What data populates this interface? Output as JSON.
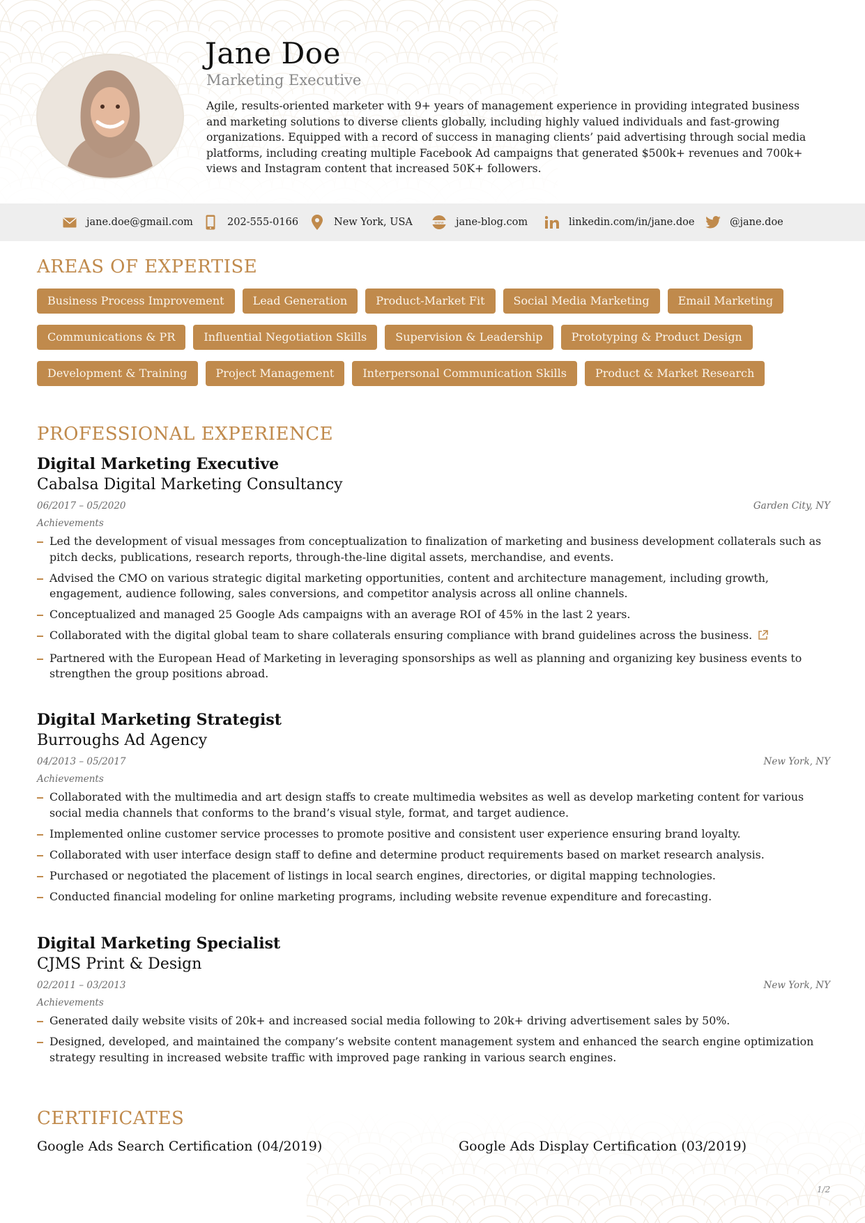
{
  "header": {
    "name": "Jane Doe",
    "title": "Marketing Executive",
    "summary": "Agile, results-oriented marketer with 9+ years of management experience in providing integrated business and marketing solutions to diverse clients globally, including highly valued individuals and fast-growing organizations. Equipped with a record of success in managing clients’ paid advertising through social media platforms, including creating multiple Facebook Ad campaigns that generated $500k+ revenues and 700k+ views and Instagram content that increased 50K+ followers."
  },
  "contact": {
    "email": "jane.doe@gmail.com",
    "phone": "202-555-0166",
    "location": "New York, USA",
    "website": "jane-blog.com",
    "website_icon_text": "www",
    "linkedin": "linkedin.com/in/jane.doe",
    "twitter": "@jane.doe",
    "icons": [
      "envelope-icon",
      "phone-icon",
      "map-pin-icon",
      "globe-icon",
      "linkedin-icon",
      "twitter-icon"
    ]
  },
  "expertise": {
    "heading": "AREAS OF EXPERTISE",
    "rows": [
      [
        "Business Process Improvement",
        "Lead Generation",
        "Product-Market Fit",
        "Social Media Marketing",
        "Email Marketing"
      ],
      [
        "Communications & PR",
        "Influential Negotiation Skills",
        "Supervision & Leadership",
        "Prototyping & Product Design"
      ],
      [
        "Development & Training",
        "Project Management",
        "Interpersonal Communication Skills",
        "Product & Market Research"
      ]
    ]
  },
  "experience": {
    "heading": "PROFESSIONAL EXPERIENCE",
    "jobs": [
      {
        "role": "Digital Marketing Executive",
        "company": "Cabalsa Digital Marketing Consultancy",
        "dates": "06/2017 – 05/2020",
        "location": "Garden City, NY",
        "achievements_label": "Achievements",
        "bullets": [
          "Led the development of visual messages from conceptualization to finalization of marketing and business development collaterals such as pitch decks, publications, research reports, through-the-line digital assets, merchandise, and events.",
          "Advised the CMO on various strategic digital marketing opportunities, content and architecture management, including growth, engagement, audience following, sales conversions, and competitor analysis across all online channels.",
          "Conceptualized and managed 25 Google Ads campaigns with an average ROI of 45% in the last 2 years.",
          "Collaborated with the digital global team to share collaterals ensuring compliance with brand guidelines across the business.",
          "Partnered with the European Head of Marketing in leveraging sponsorships as well as planning and organizing key business events to strengthen the group positions abroad."
        ]
      },
      {
        "role": "Digital Marketing Strategist",
        "company": "Burroughs Ad Agency",
        "dates": "04/2013 – 05/2017",
        "location": "New York, NY",
        "achievements_label": "Achievements",
        "bullets": [
          "Collaborated with the multimedia and art design staffs to create multimedia websites as well as develop marketing content for various social media channels that conforms to the brand’s visual style, format, and target audience.",
          "Implemented online customer service processes to promote positive and consistent user experience ensuring brand loyalty.",
          "Collaborated with user interface design staff to define and determine product requirements based on market research analysis.",
          "Purchased or negotiated the placement of listings in local search engines, directories, or digital mapping technologies.",
          "Conducted financial modeling for online marketing programs, including website revenue expenditure and forecasting."
        ]
      },
      {
        "role": "Digital Marketing Specialist",
        "company": "CJMS Print & Design",
        "dates": "02/2011 – 03/2013",
        "location": "New York, NY",
        "achievements_label": "Achievements",
        "bullets": [
          "Generated daily website visits of 20k+ and increased social media following to 20k+ driving advertisement sales by 50%.",
          "Designed, developed, and maintained the company’s website content management system and enhanced the search engine optimization strategy resulting in increased website traffic with improved page ranking in various search engines."
        ]
      }
    ]
  },
  "certificates": {
    "heading": "CERTIFICATES",
    "items": [
      "Google Ads Search Certification (04/2019)",
      "Google Ads Display Certification (03/2019)"
    ]
  },
  "page": {
    "number": "1/2"
  },
  "colors": {
    "accent": "#c08a4c",
    "contact_bar": "#eeeeee",
    "deco": "#f3ede3"
  }
}
